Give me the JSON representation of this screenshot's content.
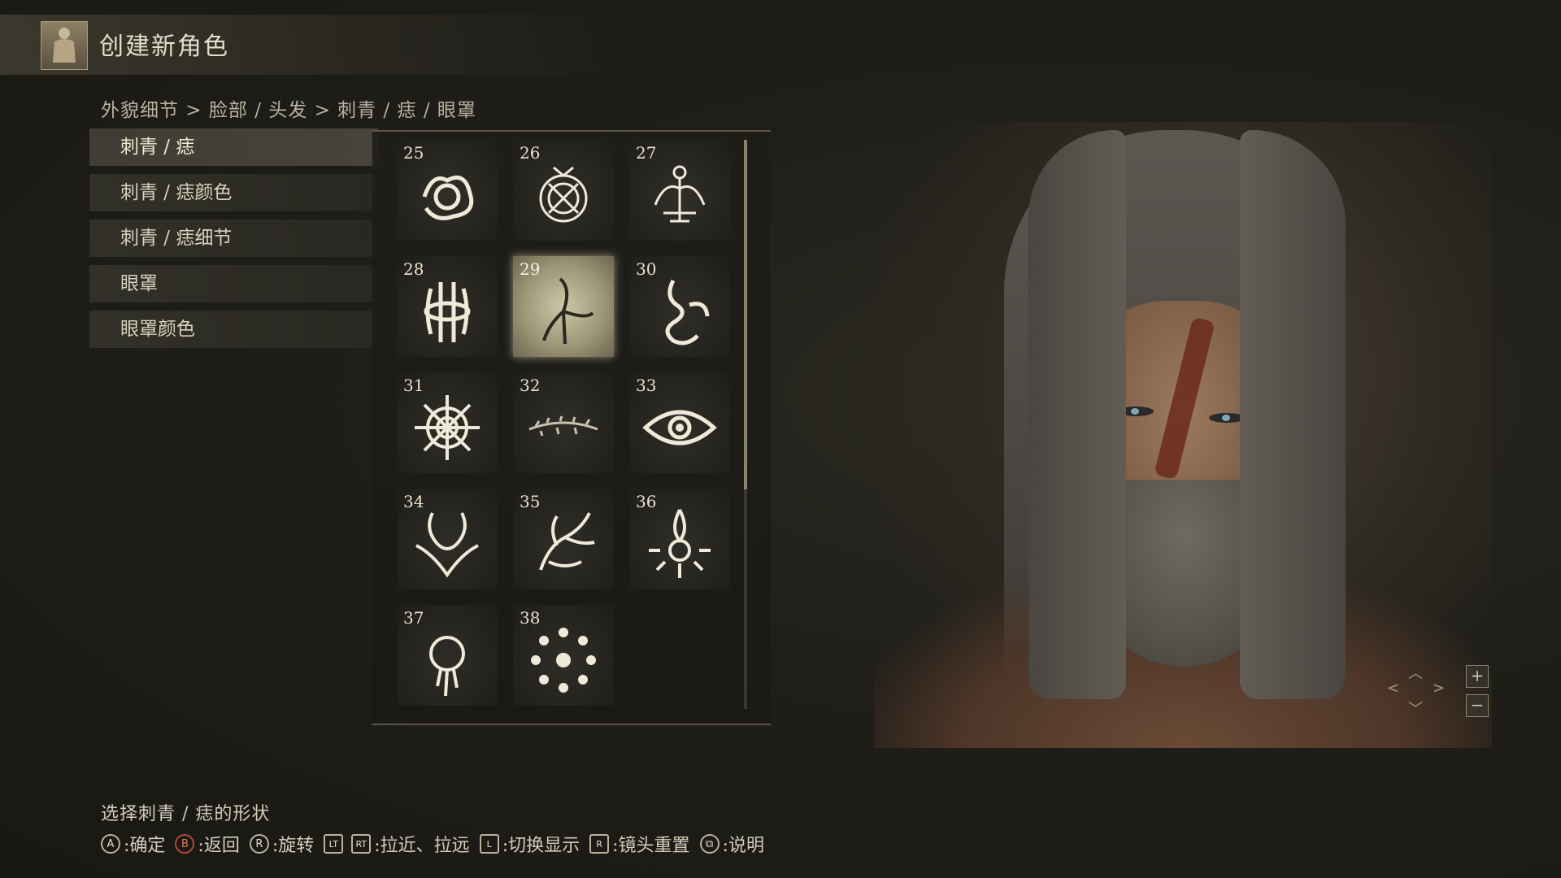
{
  "header": {
    "title": "创建新角色",
    "avatar_icon": "character-avatar-icon"
  },
  "breadcrumb": "外貌细节 > 脸部 / 头发 > 刺青 / 痣 / 眼罩",
  "menu": {
    "items": [
      {
        "label": "刺青 / 痣",
        "active": true
      },
      {
        "label": "刺青 / 痣颜色",
        "active": false
      },
      {
        "label": "刺青 / 痣细节",
        "active": false
      },
      {
        "label": "眼罩",
        "active": false
      },
      {
        "label": "眼罩颜色",
        "active": false
      }
    ]
  },
  "grid": {
    "selected": "29",
    "tiles": [
      {
        "num": "25",
        "icon": "swirl-rose-icon"
      },
      {
        "num": "26",
        "icon": "crossed-swords-crest-icon"
      },
      {
        "num": "27",
        "icon": "winged-shrine-icon"
      },
      {
        "num": "28",
        "icon": "bound-rune-icon"
      },
      {
        "num": "29",
        "icon": "tri-claw-mark-icon"
      },
      {
        "num": "30",
        "icon": "serpent-flame-icon"
      },
      {
        "num": "31",
        "icon": "floral-knot-icon"
      },
      {
        "num": "32",
        "icon": "thorn-line-icon"
      },
      {
        "num": "33",
        "icon": "all-seeing-eye-icon"
      },
      {
        "num": "34",
        "icon": "horned-beast-icon"
      },
      {
        "num": "35",
        "icon": "dragon-rider-icon"
      },
      {
        "num": "36",
        "icon": "flame-eye-icon"
      },
      {
        "num": "37",
        "icon": "black-sun-icon"
      },
      {
        "num": "38",
        "icon": "circle-of-orbs-icon"
      }
    ]
  },
  "footer": {
    "hint": "选择刺青 / 痣的形状",
    "controls": [
      {
        "glyph": "A",
        "label": ":确定"
      },
      {
        "glyph": "B",
        "label": ":返回"
      },
      {
        "glyph": "R",
        "label": ":旋转"
      },
      {
        "glyph": "LT",
        "label": ""
      },
      {
        "glyph": "RT",
        "label": ":拉近、拉远"
      },
      {
        "glyph": "L",
        "label": ":切换显示"
      },
      {
        "glyph": "R",
        "label": ":镜头重置"
      },
      {
        "glyph": "⧉",
        "label": ":说明"
      }
    ]
  },
  "camera": {
    "zoom_in": "+",
    "zoom_out": "−"
  }
}
